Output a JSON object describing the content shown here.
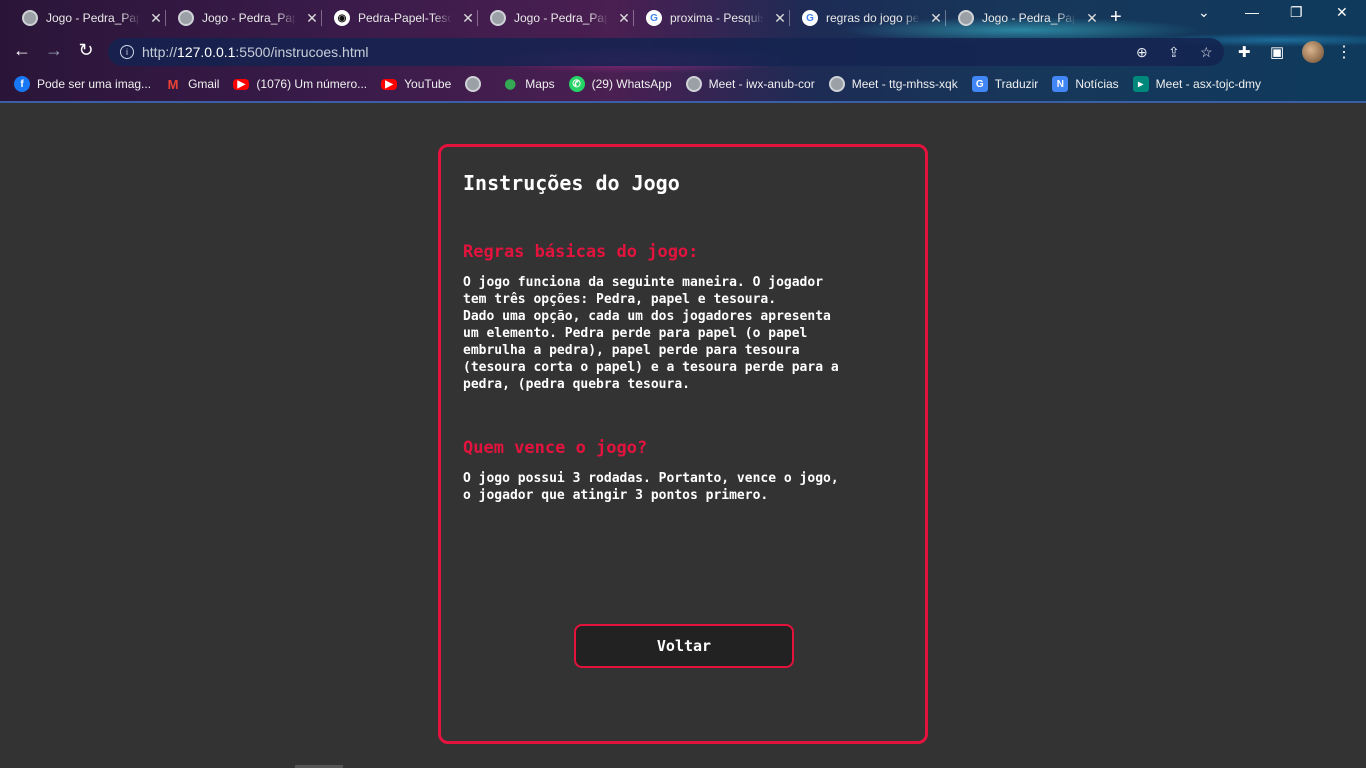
{
  "browser": {
    "tabs": [
      {
        "title": "Jogo - Pedra_Papel",
        "icon": "globe-icon"
      },
      {
        "title": "Jogo - Pedra_Papel",
        "icon": "globe-icon"
      },
      {
        "title": "Pedra-Papel-Tesoura",
        "icon": "github-icon"
      },
      {
        "title": "Jogo - Pedra_Papel",
        "icon": "globe-icon"
      },
      {
        "title": "proxima - Pesquisa",
        "icon": "google-icon"
      },
      {
        "title": "regras do jogo pedra",
        "icon": "google-icon"
      },
      {
        "title": "Jogo - Pedra_Papel",
        "icon": "globe-icon"
      }
    ],
    "url_host": "127.0.0.1",
    "url_prefix": "http://",
    "url_rest": ":5500/instrucoes.html",
    "bookmarks": [
      {
        "label": "Pode ser uma imag...",
        "icon": "facebook-icon"
      },
      {
        "label": "Gmail",
        "icon": "gmail-icon"
      },
      {
        "label": "(1076) Um número...",
        "icon": "youtube-icon"
      },
      {
        "label": "YouTube",
        "icon": "youtube-icon"
      },
      {
        "label": "",
        "icon": "globe-icon"
      },
      {
        "label": "Maps",
        "icon": "maps-icon"
      },
      {
        "label": "(29) WhatsApp",
        "icon": "whatsapp-icon"
      },
      {
        "label": "Meet - iwx-anub-cor",
        "icon": "globe-icon"
      },
      {
        "label": "Meet - ttg-mhss-xqk",
        "icon": "globe-icon"
      },
      {
        "label": "Traduzir",
        "icon": "translate-icon"
      },
      {
        "label": "Notícias",
        "icon": "news-icon"
      },
      {
        "label": "Meet - asx-tojc-dmy",
        "icon": "meet-icon"
      }
    ]
  },
  "page": {
    "title": "Instruções do Jogo",
    "rules_heading": "Regras básicas do jogo:",
    "rules_text": "O jogo funciona da seguinte maneira. O jogador\ntem três opções: Pedra, papel e tesoura.\nDado uma opção, cada um dos jogadores apresenta\num elemento. Pedra perde para papel (o papel\nembrulha a pedra), papel perde para tesoura\n(tesoura corta o papel) e a tesoura perde para a\npedra, (pedra quebra tesoura.",
    "winner_heading": "Quem vence o jogo?",
    "winner_text": "O jogo possui 3 rodadas. Portanto, vence o jogo,\no jogador que atingir 3 pontos primero.",
    "back_label": "Voltar"
  },
  "colors": {
    "accent": "#e4133e",
    "background": "#333333",
    "button_bg": "#222222",
    "text": "#ffffff"
  }
}
